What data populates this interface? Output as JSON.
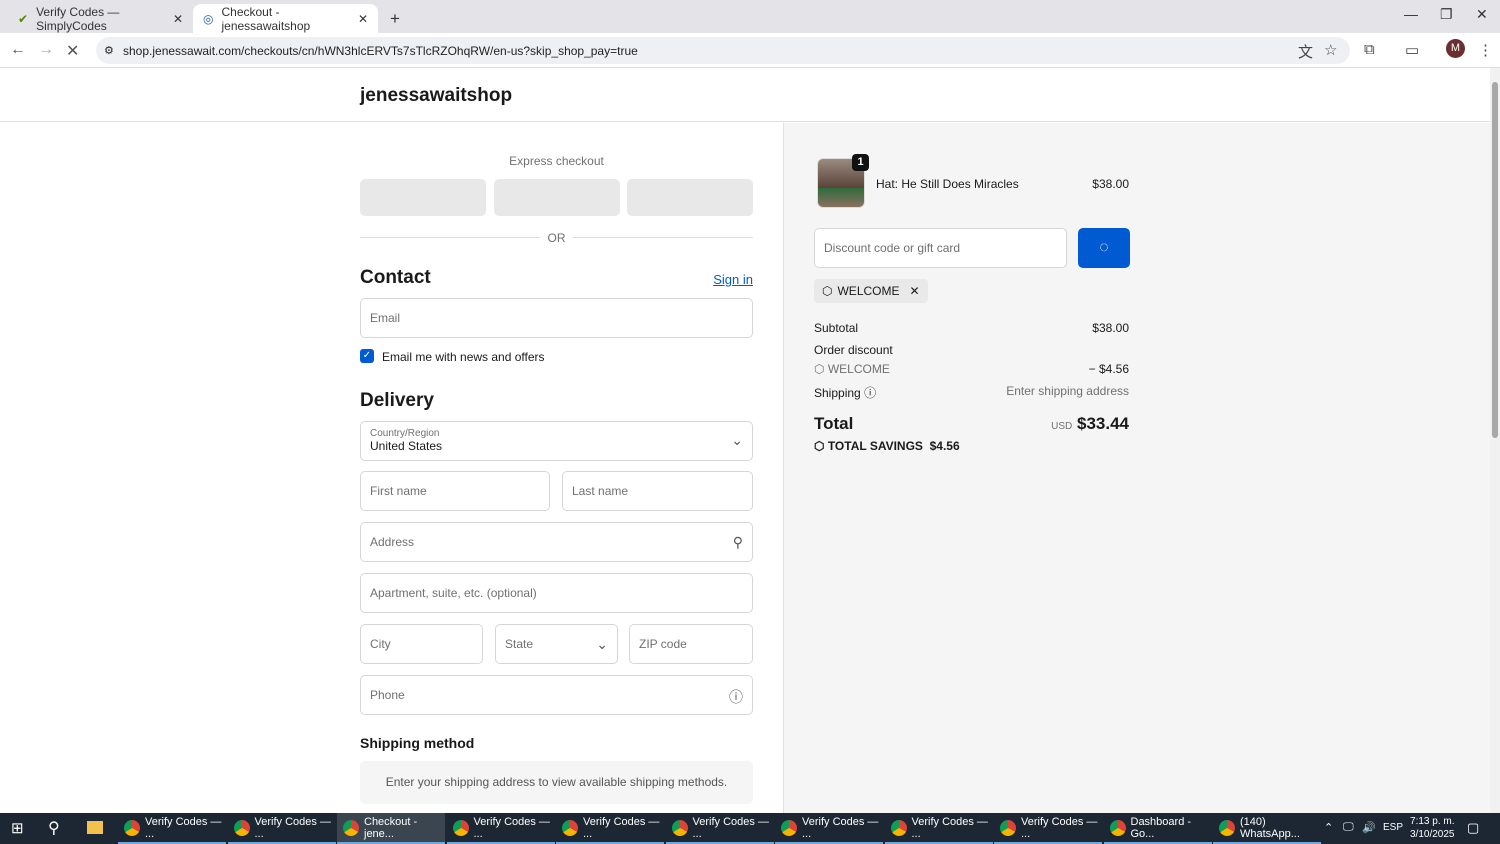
{
  "browser": {
    "tabs": [
      {
        "title": "Verify Codes — SimplyCodes"
      },
      {
        "title": "Checkout - jenessawaitshop"
      }
    ],
    "url": "shop.jenessawait.com/checkouts/cn/hWN3hlcERVTs7sTlcRZOhqRW/en-us?skip_shop_pay=true",
    "profile_initial": "M"
  },
  "shop": {
    "name": "jenessawaitshop"
  },
  "checkout": {
    "express_label": "Express checkout",
    "or": "OR",
    "contact_title": "Contact",
    "sign_in": "Sign in",
    "email_placeholder": "Email",
    "newsletter_label": "Email me with news and offers",
    "newsletter_checked": true,
    "delivery_title": "Delivery",
    "country_label": "Country/Region",
    "country_value": "United States",
    "first_name": "First name",
    "last_name": "Last name",
    "address": "Address",
    "apartment": "Apartment, suite, etc. (optional)",
    "city": "City",
    "state": "State",
    "zip": "ZIP code",
    "phone": "Phone",
    "shipping_method_title": "Shipping method",
    "shipping_method_msg": "Enter your shipping address to view available shipping methods."
  },
  "summary": {
    "item": {
      "name": "Hat: He Still Does Miracles",
      "price": "$38.00",
      "qty": "1"
    },
    "discount_placeholder": "Discount code or gift card",
    "applied_code": "WELCOME",
    "subtotal_label": "Subtotal",
    "subtotal": "$38.00",
    "order_discount_label": "Order discount",
    "discount_code": "WELCOME",
    "discount_amount": "− $4.56",
    "shipping_label": "Shipping",
    "shipping_value": "Enter shipping address",
    "total_label": "Total",
    "currency": "USD",
    "total": "$33.44",
    "savings_label": "TOTAL SAVINGS",
    "savings": "$4.56",
    "accent": "#005bd3"
  },
  "taskbar": {
    "items": [
      "Verify Codes — ...",
      "Verify Codes — ...",
      "Checkout - jene...",
      "Verify Codes — ...",
      "Verify Codes — ...",
      "Verify Codes — ...",
      "Verify Codes — ...",
      "Verify Codes — ...",
      "Verify Codes — ...",
      "Dashboard - Go...",
      "(140) WhatsApp..."
    ],
    "lang": "ESP",
    "time": "7:13 p. m.",
    "date": "3/10/2025"
  }
}
